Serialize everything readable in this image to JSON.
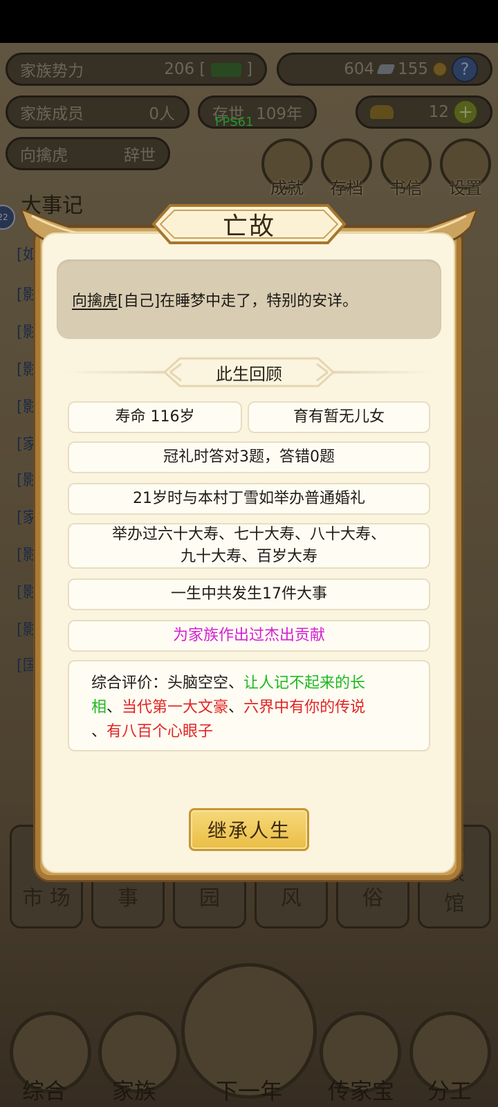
{
  "top_bar": {
    "clan_power_label": "家族势力",
    "clan_power_value": "206",
    "clan_power_open": "[",
    "clan_power_close": "]",
    "silver_value": "604",
    "copper_value": "155",
    "help_icon": "question-icon"
  },
  "second_bar": {
    "members_label": "家族成员",
    "members_value": "0人",
    "exist_label": "存世",
    "exist_value": "109年",
    "gold_value": "12",
    "add_icon": "plus-icon"
  },
  "fps": "FPS61",
  "person_bar": {
    "name": "向擒虎",
    "status": "辞世"
  },
  "round_buttons": [
    {
      "label": "成就",
      "icon": "achievement-icon"
    },
    {
      "label": "存档",
      "icon": "save-icon"
    },
    {
      "label": "书信",
      "icon": "letter-icon"
    },
    {
      "label": "设置",
      "icon": "settings-icon"
    }
  ],
  "events_title": "大事记",
  "pager_count": "22",
  "side_tags": [
    "[如",
    "[影",
    "[影",
    "[影",
    "[影",
    "[家",
    "[影",
    "[家",
    "[影",
    "[影",
    "[影",
    "[国"
  ],
  "nav_cards": [
    "市\n场",
    "事",
    "园",
    "风",
    "俗",
    "红\n娘\n馆"
  ],
  "bottom_nav": [
    {
      "label": "综合",
      "icon": "scroll-icon"
    },
    {
      "label": "家族",
      "icon": "temple-icon"
    },
    {
      "label": "下一年",
      "icon": "mountain-icon"
    },
    {
      "label": "传家宝",
      "icon": "treasure-icon"
    },
    {
      "label": "分工",
      "icon": "worker-icon"
    }
  ],
  "dialog": {
    "title": "亡故",
    "message_name": "向擒虎",
    "message_rest": "[自己]在睡梦中走了，特别的安详。",
    "section_title": "此生回顾",
    "lifespan": "寿命 116岁",
    "children": "育有暂无儿女",
    "capping": "冠礼时答对3题，答错0题",
    "marriage": "21岁时与本村丁雪如举办普通婚礼",
    "birthdays_line1": "举办过六十大寿、七十大寿、八十大寿、",
    "birthdays_line2": "九十大寿、百岁大寿",
    "events_count": "一生中共发生17件大事",
    "contribution": "为家族作出过杰出贡献",
    "evaluation": {
      "prefix": "综合评价：头脑空空、",
      "green_1": "让人记不起来的长",
      "green_2": "相",
      "sep_1": "、",
      "red_1": "当代第一大文豪",
      "sep_2": "、",
      "red_2": "六界中有你的传说",
      "sep_3": "、",
      "red_3": "有八百个心眼子"
    },
    "inherit_button": "继承人生",
    "colors": {
      "purple": "#d31fd6",
      "green": "#1eb81e",
      "red": "#e02424",
      "button_gold": "#eabd45"
    }
  }
}
